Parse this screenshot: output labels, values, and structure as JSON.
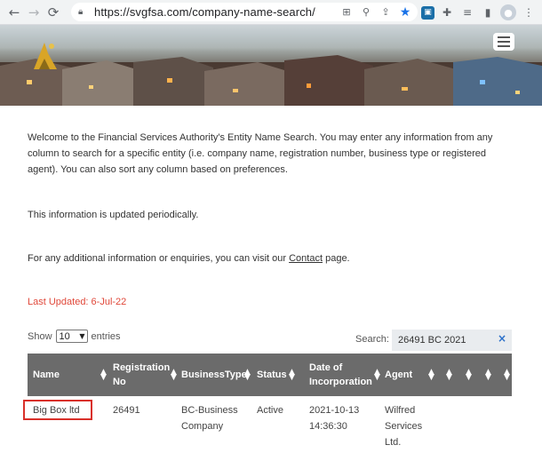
{
  "browser": {
    "url": "https://svgfsa.com/company-name-search/"
  },
  "page": {
    "intro": "Welcome to the Financial Services Authority's Entity Name Search. You may enter any information from any column to search for a specific entity (i.e. company name, registration number, business type or registered agent). You can also sort any column based on preferences.",
    "updated_note": "This information is updated periodically.",
    "contact_prefix": "For any additional information or enquiries, you can visit our ",
    "contact_link": "Contact",
    "contact_suffix": " page.",
    "last_updated": "Last Updated:  6-Jul-22"
  },
  "table_controls": {
    "show_label": "Show",
    "entries_value": "10",
    "entries_label": "entries",
    "search_label": "Search:",
    "search_value": "26491 BC 2021"
  },
  "table": {
    "headers": [
      "Name",
      "Registration No",
      "BusinessType",
      "Status",
      "Date of Incorporation",
      "Agent"
    ],
    "rows": [
      [
        "Big Box ltd",
        "26491",
        "BC-Business Company",
        "Active",
        "2021-10-13 14:36:30",
        "Wilfred Services Ltd."
      ]
    ]
  },
  "colors": {
    "accent_red": "#e0483a",
    "header_bg": "#6b6b6b",
    "highlight_box": "#d9302a",
    "search_clear": "#2a6fc9"
  }
}
